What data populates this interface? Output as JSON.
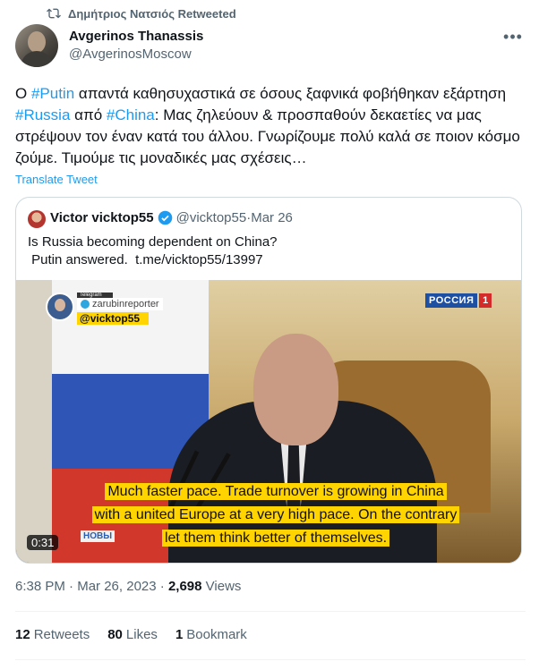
{
  "retweet": {
    "by": "Δημήτριος Νατσιός",
    "suffix": "Retweeted"
  },
  "tweet": {
    "author_name": "Avgerinos Thanassis",
    "author_handle": "@AvgerinosMoscow",
    "text_parts": [
      {
        "t": "Ο ",
        "tag": false
      },
      {
        "t": "#Putin",
        "tag": true
      },
      {
        "t": " απαντά καθησυχαστικά σε όσους ξαφνικά φοβήθηκαν εξάρτηση ",
        "tag": false
      },
      {
        "t": "#Russia",
        "tag": true
      },
      {
        "t": " από ",
        "tag": false
      },
      {
        "t": "#China",
        "tag": true
      },
      {
        "t": ": Μας ζηλεύουν & προσπαθούν δεκαετίες να μας στρέψουν τον έναν κατά του άλλου. Γνωρίζουμε πολύ καλά σε ποιον κόσμο ζούμε. Τιμούμε τις μοναδικές μας σχέσεις…",
        "tag": false
      }
    ],
    "translate_label": "Translate Tweet",
    "more_label": "•••"
  },
  "quote": {
    "author_name": "Victor vicktop55",
    "author_handle": "@vicktop55",
    "separator": " · ",
    "date": "Mar 26",
    "text": "Is Russia becoming dependent on China?\n Putin answered.  t.me/vicktop55/13997",
    "video": {
      "channel_logo": "РОССИЯ",
      "channel_number": "1",
      "telegram_label": "Telegram",
      "telegram_channel": "zarubinreporter",
      "telegram_handle": "@vicktop55",
      "subtitle_lines": [
        "Much faster pace.  Trade turnover is growing in China",
        "with a united Europe at a very high pace.  On the contrary",
        "let them think better of themselves."
      ],
      "ticker": "НОВЫ",
      "duration": "0:31"
    }
  },
  "meta": {
    "time": "6:38 PM",
    "separator": " · ",
    "date": "Mar 26, 2023",
    "views_count": "2,698",
    "views_label": "Views"
  },
  "stats": [
    {
      "count": "12",
      "label": "Retweets"
    },
    {
      "count": "80",
      "label": "Likes"
    },
    {
      "count": "1",
      "label": "Bookmark"
    }
  ],
  "colors": {
    "accent": "#1d9bf0",
    "secondary_text": "#536471",
    "subtitle_bg": "#ffd400"
  }
}
